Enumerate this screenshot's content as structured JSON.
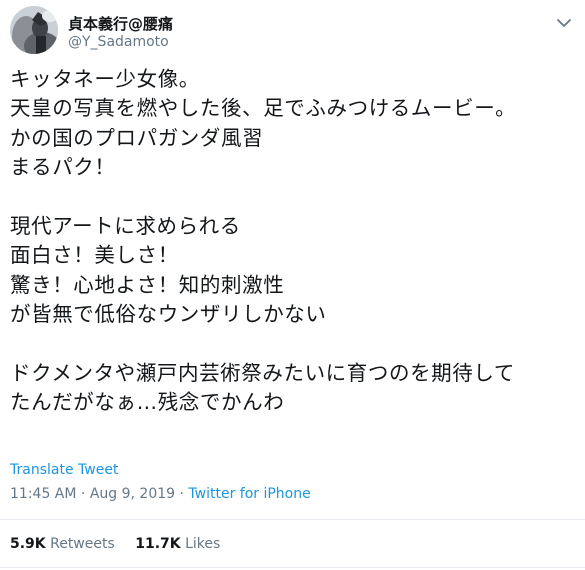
{
  "user": {
    "display_name": "貞本義行@腰痛",
    "handle": "@Y_Sadamoto"
  },
  "tweet": {
    "lines": [
      "キッタネー少女像。",
      "天皇の写真を燃やした後、足でふみつけるムービー。",
      "かの国のプロパガンダ風習",
      "まるパク！",
      "",
      "現代アートに求められる",
      "面白さ！美しさ！",
      "驚き！心地よさ！知的刺激性",
      "が皆無で低俗なウンザリしかない",
      "",
      "ドクメンタや瀬戸内芸術祭みたいに育つのを期待して",
      "たんだがなぁ…残念でかんわ"
    ],
    "translate_label": "Translate Tweet",
    "time": "11:45 AM",
    "date": "Aug 9, 2019",
    "separator": "·",
    "source": "Twitter for iPhone"
  },
  "stats": {
    "retweets_count": "5.9K",
    "retweets_label": "Retweets",
    "likes_count": "11.7K",
    "likes_label": "Likes"
  },
  "colors": {
    "link": "#1b95e0",
    "secondary_text": "#657786",
    "primary_text": "#14171a",
    "divider": "#e6ecf0"
  },
  "icons": {
    "avatar": "profile-photo",
    "menu": "chevron-down-icon"
  }
}
